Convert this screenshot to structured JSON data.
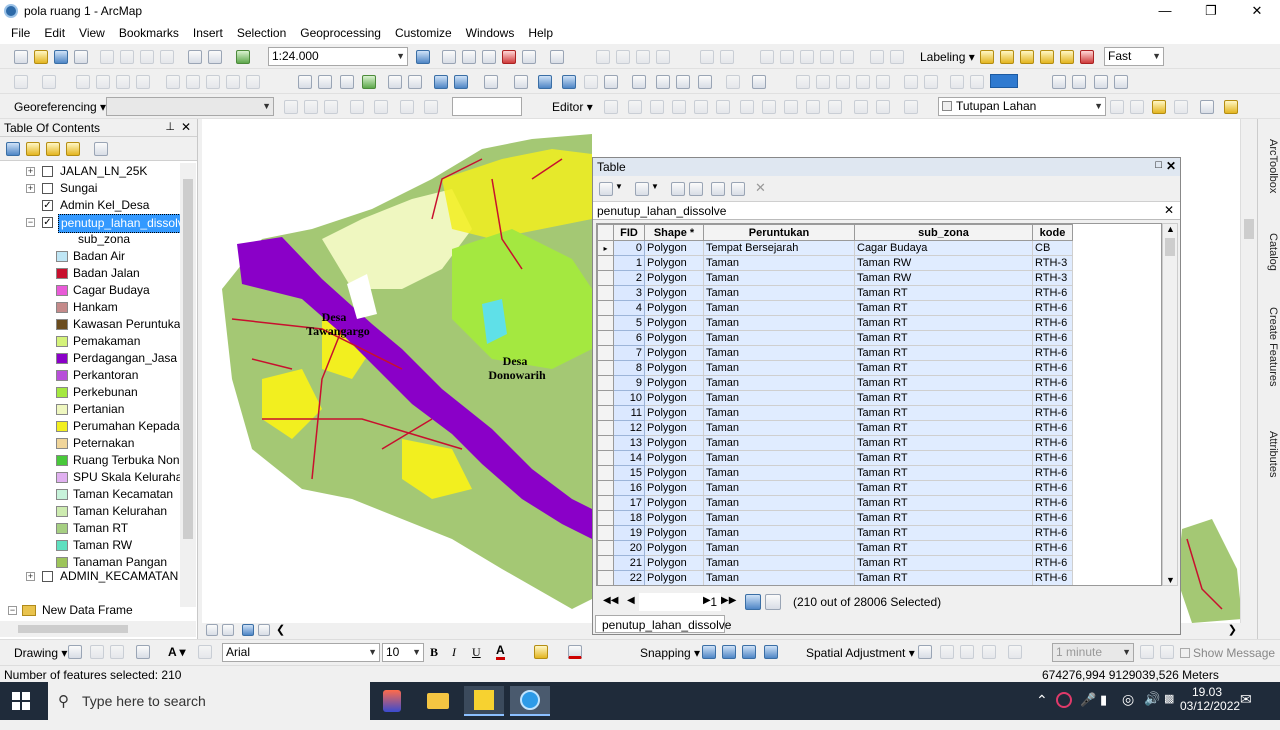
{
  "window": {
    "title": "pola ruang 1 - ArcMap"
  },
  "menu": [
    "File",
    "Edit",
    "View",
    "Bookmarks",
    "Insert",
    "Selection",
    "Geoprocessing",
    "Customize",
    "Windows",
    "Help"
  ],
  "toolbar": {
    "scale": "1:24.000",
    "labeling": "Labeling",
    "quality": "Fast",
    "georeferencing": "Georeferencing",
    "editor": "Editor",
    "layer_select": "Tutupan Lahan"
  },
  "toc": {
    "title": "Table Of Contents",
    "layers": [
      {
        "name": "JALAN_LN_25K",
        "checked": false,
        "expandable": true
      },
      {
        "name": "Sungai",
        "checked": false,
        "expandable": true
      },
      {
        "name": "Admin Kel_Desa",
        "checked": true,
        "expandable": false
      },
      {
        "name": "penutup_lahan_dissolve",
        "checked": true,
        "expandable": true,
        "selected": true
      }
    ],
    "legend_field": "sub_zona",
    "legend": [
      {
        "label": "Badan Air",
        "color": "#bfe6f5"
      },
      {
        "label": "Badan Jalan",
        "color": "#c8102e"
      },
      {
        "label": "Cagar Budaya",
        "color": "#e85bd7"
      },
      {
        "label": "Hankam",
        "color": "#c48a8a"
      },
      {
        "label": "Kawasan Peruntukan",
        "color": "#6b4c1e"
      },
      {
        "label": "Pemakaman",
        "color": "#d4f27a"
      },
      {
        "label": "Perdagangan_Jasa Sk",
        "color": "#8a00c8"
      },
      {
        "label": "Perkantoran",
        "color": "#b84fd9"
      },
      {
        "label": "Perkebunan",
        "color": "#a4e840"
      },
      {
        "label": "Pertanian",
        "color": "#eff7c0"
      },
      {
        "label": "Perumahan Kepadata",
        "color": "#f2ef1f"
      },
      {
        "label": "Peternakan",
        "color": "#f0d59a"
      },
      {
        "label": "Ruang Terbuka Non H",
        "color": "#48c83a"
      },
      {
        "label": "SPU Skala Kelurahan",
        "color": "#e0b0f0"
      },
      {
        "label": "Taman Kecamatan",
        "color": "#c7f2da"
      },
      {
        "label": "Taman Kelurahan",
        "color": "#cdebb0"
      },
      {
        "label": "Taman RT",
        "color": "#a6cf82"
      },
      {
        "label": "Taman RW",
        "color": "#5fe0c0"
      },
      {
        "label": "Tanaman Pangan",
        "color": "#9dc45a"
      }
    ],
    "admin_kecamatan": "ADMIN_KECAMATAN",
    "frame": "New Data Frame"
  },
  "map": {
    "labels": [
      "Desa\nTawangargo",
      "Desa\nDonowarih"
    ]
  },
  "table": {
    "window_title": "Table",
    "tab_name": "penutup_lahan_dissolve",
    "columns": [
      "FID",
      "Shape *",
      "Peruntukan",
      "sub_zona",
      "kode"
    ],
    "rows": [
      [
        "0",
        "Polygon",
        "Tempat Bersejarah",
        "Cagar Budaya",
        "CB"
      ],
      [
        "1",
        "Polygon",
        "Taman",
        "Taman RW",
        "RTH-3"
      ],
      [
        "2",
        "Polygon",
        "Taman",
        "Taman RW",
        "RTH-3"
      ],
      [
        "3",
        "Polygon",
        "Taman",
        "Taman RT",
        "RTH-6"
      ],
      [
        "4",
        "Polygon",
        "Taman",
        "Taman RT",
        "RTH-6"
      ],
      [
        "5",
        "Polygon",
        "Taman",
        "Taman RT",
        "RTH-6"
      ],
      [
        "6",
        "Polygon",
        "Taman",
        "Taman RT",
        "RTH-6"
      ],
      [
        "7",
        "Polygon",
        "Taman",
        "Taman RT",
        "RTH-6"
      ],
      [
        "8",
        "Polygon",
        "Taman",
        "Taman RT",
        "RTH-6"
      ],
      [
        "9",
        "Polygon",
        "Taman",
        "Taman RT",
        "RTH-6"
      ],
      [
        "10",
        "Polygon",
        "Taman",
        "Taman RT",
        "RTH-6"
      ],
      [
        "11",
        "Polygon",
        "Taman",
        "Taman RT",
        "RTH-6"
      ],
      [
        "12",
        "Polygon",
        "Taman",
        "Taman RT",
        "RTH-6"
      ],
      [
        "13",
        "Polygon",
        "Taman",
        "Taman RT",
        "RTH-6"
      ],
      [
        "14",
        "Polygon",
        "Taman",
        "Taman RT",
        "RTH-6"
      ],
      [
        "15",
        "Polygon",
        "Taman",
        "Taman RT",
        "RTH-6"
      ],
      [
        "16",
        "Polygon",
        "Taman",
        "Taman RT",
        "RTH-6"
      ],
      [
        "17",
        "Polygon",
        "Taman",
        "Taman RT",
        "RTH-6"
      ],
      [
        "18",
        "Polygon",
        "Taman",
        "Taman RT",
        "RTH-6"
      ],
      [
        "19",
        "Polygon",
        "Taman",
        "Taman RT",
        "RTH-6"
      ],
      [
        "20",
        "Polygon",
        "Taman",
        "Taman RT",
        "RTH-6"
      ],
      [
        "21",
        "Polygon",
        "Taman",
        "Taman RT",
        "RTH-6"
      ],
      [
        "22",
        "Polygon",
        "Taman",
        "Taman RT",
        "RTH-6"
      ]
    ],
    "record": "1",
    "selection_text": "(210 out of 28006 Selected)",
    "bottom_tab": "penutup_lahan_dissolve"
  },
  "dock_tabs": [
    "ArcToolbox",
    "Catalog",
    "Create Features",
    "Attributes"
  ],
  "drawing": {
    "label": "Drawing",
    "font": "Arial",
    "size": "10",
    "snapping": "Snapping",
    "spatial_adjustment": "Spatial Adjustment",
    "interval": "1 minute",
    "show_message": "Show Message"
  },
  "status": {
    "left": "Number of features selected: 210",
    "coords": "674276,994  9129039,526 Meters"
  },
  "taskbar": {
    "search_placeholder": "Type here to search",
    "time": "19.03",
    "date": "03/12/2022"
  }
}
